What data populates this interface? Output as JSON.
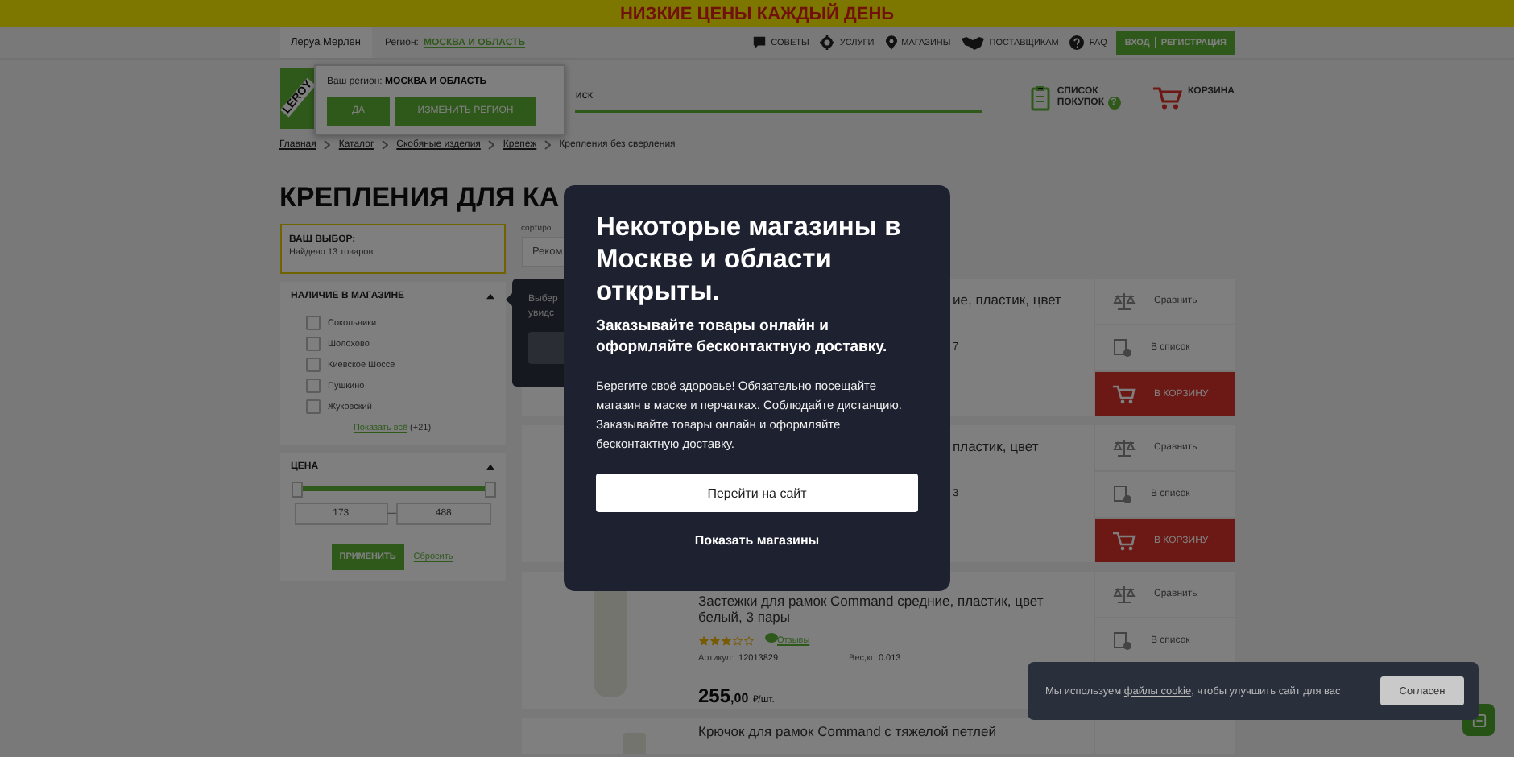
{
  "promo_banner": {
    "text": "НИЗКИЕ ЦЕНЫ КАЖДЫЙ ДЕНЬ"
  },
  "top_bar": {
    "tabs": [
      {
        "label": "Леруа Мерлен",
        "selected": true
      }
    ],
    "region_label": "Регион:",
    "region_link": "МОСКВА И ОБЛАСТЬ",
    "nav": [
      {
        "label": "СОВЕТЫ",
        "kind": "tips"
      },
      {
        "label": "УСЛУГИ",
        "kind": "services"
      },
      {
        "label": "МАГАЗИНЫ",
        "kind": "stores"
      },
      {
        "label": "ПОСТАВЩИКАМ",
        "kind": "suppliers"
      },
      {
        "label": "FAQ",
        "kind": "faq"
      }
    ],
    "login": "ВХОД",
    "register": "РЕГИСТРАЦИЯ"
  },
  "header": {
    "logo_text": "LEROY",
    "search": {
      "placeholder": "иск"
    },
    "shopping_list": {
      "lines": [
        "СПИСОК",
        "ПОКУПОК"
      ],
      "badge": "?"
    },
    "cart": {
      "label": "КОРЗИНА"
    }
  },
  "region_popup": {
    "text": "Ваш регион: **МОСКВА И ОБЛАСТЬ**",
    "buttons": [
      "ДА",
      "ИЗМЕНИТЬ РЕГИОН"
    ]
  },
  "breadcrumbs": [
    "Главная",
    "Каталог",
    "Скобяные изделия",
    "Крепеж",
    "Крепления без сверления"
  ],
  "page_title": "КРЕПЛЕНИЯ ДЛЯ КА",
  "sidebar": {
    "selection": {
      "title": "ВАШ ВЫБОР:",
      "found": "Найдено 13 товаров"
    },
    "stores_filter": {
      "title": "НАЛИЧИЕ В МАГАЗИНЕ",
      "expanded": true,
      "options": [
        {
          "label": "Сокольники",
          "checked": false
        },
        {
          "label": "Шолохово",
          "checked": false
        },
        {
          "label": "Киевское Шоссе",
          "checked": false
        },
        {
          "label": "Пушкино",
          "checked": false
        },
        {
          "label": "Жуковский",
          "checked": false
        }
      ],
      "show_all": "Показать всё",
      "more_count": "(+21)"
    },
    "price_filter": {
      "title": "ЦЕНА",
      "expanded": true,
      "level": 1,
      "min": "173",
      "separator": "—",
      "max": "488",
      "apply": "ПРИМЕНИТЬ",
      "reset": "Сбросить"
    }
  },
  "sorting": {
    "label": "сортиро",
    "value": "Реком"
  },
  "tooltip": {
    "lines": [
      "Выбер",
      "увидс"
    ]
  },
  "products": [
    {
      "kind": "fragment",
      "title": "ие, пластик, цвет",
      "article_fragment": "7",
      "actions": [
        {
          "label": "Сравнить",
          "kind": "compare"
        },
        {
          "label": "В список",
          "kind": "list"
        },
        {
          "label": "В КОРЗИНУ",
          "kind": "cart"
        }
      ]
    },
    {
      "kind": "fragment",
      "title": "пластик, цвет",
      "article_fragment": "3",
      "actions": [
        {
          "label": "Сравнить",
          "kind": "compare"
        },
        {
          "label": "В список",
          "kind": "list"
        },
        {
          "label": "В КОРЗИНУ",
          "kind": "cart"
        }
      ]
    },
    {
      "kind": "full",
      "title": "Застежки для рамок Command средние, пластик, цвет белый, 3 пары",
      "stars": 3,
      "reviews": "Отзывы",
      "article_label": "Артикул:",
      "article": "12013829",
      "weight_label": "Вес,кг",
      "weight": "0.013",
      "price": "255",
      "cents": ",00",
      "unit": "₽/шт.",
      "actions": [
        {
          "label": "Сравнить",
          "kind": "compare"
        },
        {
          "label": "В список",
          "kind": "list"
        }
      ]
    },
    {
      "kind": "title",
      "title": "Крючок для рамок Command с тяжелой петлей"
    }
  ],
  "modal": {
    "title": "Некоторые магазины в Москве и области открыты.",
    "subtitle": "Заказывайте товары онлайн и оформляйте бесконтактную доставку.",
    "body": "Берегите своё здоровье! Обязательно посещайте магазин в маске и перчатках. Соблюдайте дистанцию. Заказывайте товары онлайн и оформляйте бесконтактную доставку.",
    "primary": "Перейти на сайт",
    "secondary": "Показать магазины"
  },
  "cookie_banner": {
    "text_start": "Мы используем ",
    "link": "файлы cookie",
    "text_end": ", чтобы улучшить сайт для вас",
    "button": "Согласен"
  }
}
